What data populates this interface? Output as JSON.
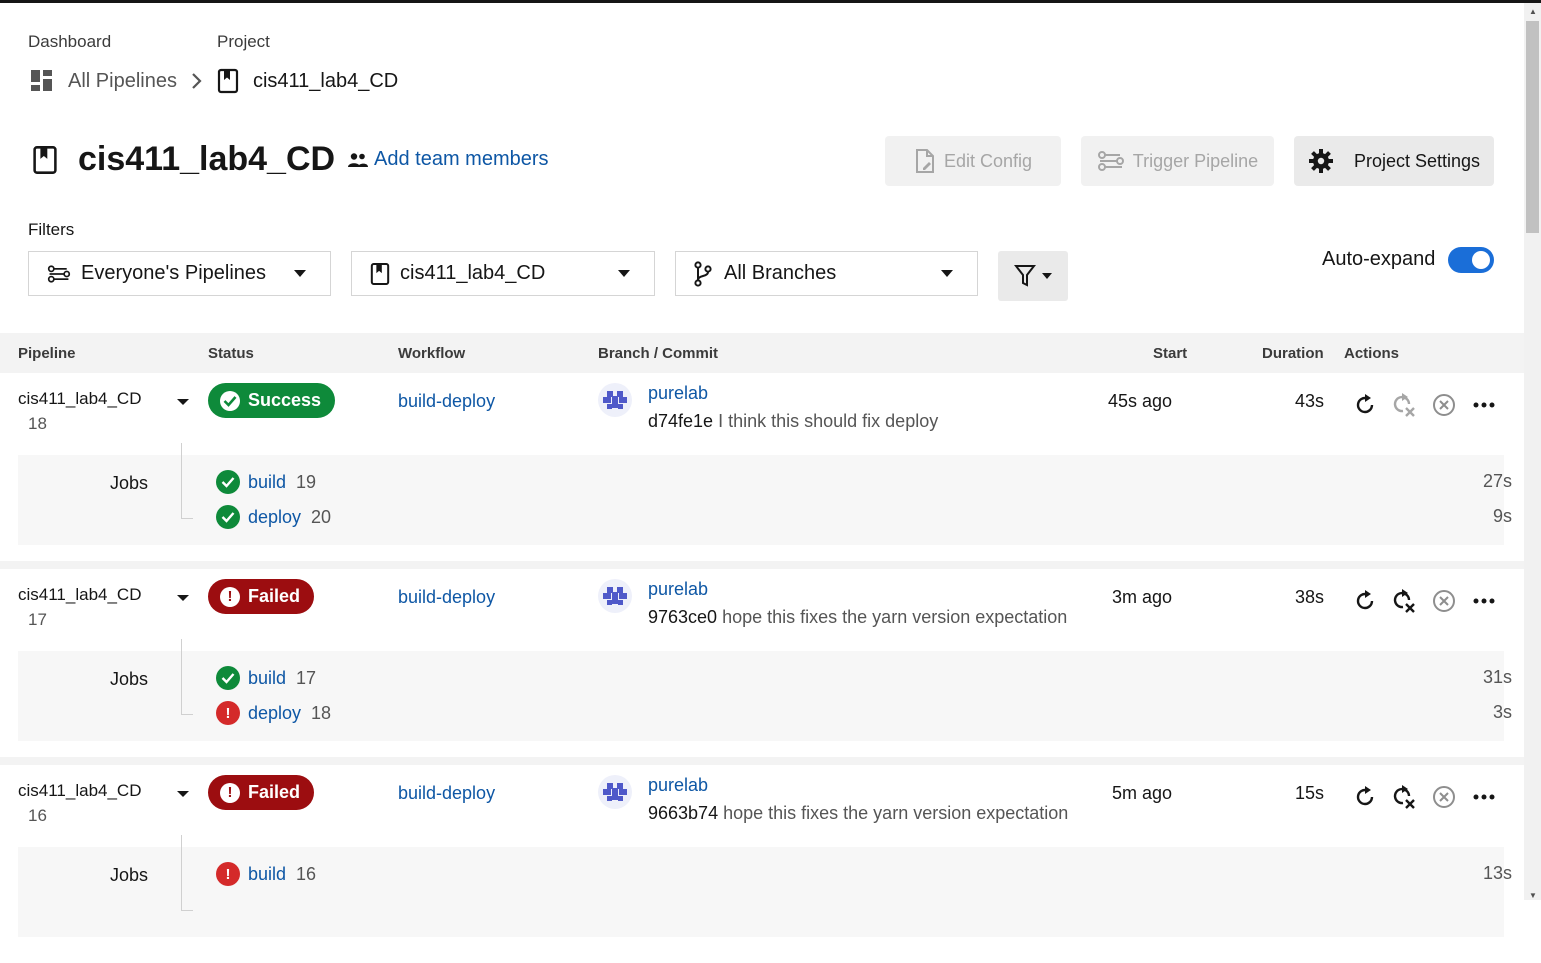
{
  "breadcrumb": {
    "dashboard_label": "Dashboard",
    "project_label": "Project",
    "all_pipelines": "All Pipelines",
    "project_name": "cis411_lab4_CD"
  },
  "header": {
    "title": "cis411_lab4_CD",
    "add_team": "Add team members",
    "edit_config": "Edit Config",
    "trigger_pipeline": "Trigger Pipeline",
    "project_settings": "Project Settings"
  },
  "filters": {
    "label": "Filters",
    "pipelines": "Everyone's Pipelines",
    "project": "cis411_lab4_CD",
    "branches": "All Branches",
    "auto_expand": "Auto-expand",
    "auto_expand_on": true
  },
  "table": {
    "headers": {
      "pipeline": "Pipeline",
      "status": "Status",
      "workflow": "Workflow",
      "branch_commit": "Branch / Commit",
      "start": "Start",
      "duration": "Duration",
      "actions": "Actions"
    },
    "jobs_label": "Jobs",
    "rows": [
      {
        "name": "cis411_lab4_CD",
        "number": "18",
        "status": "Success",
        "status_type": "success",
        "workflow": "build-deploy",
        "author": "purelab",
        "sha": "d74fe1e",
        "message": "I think this should fix deploy",
        "start": "45s ago",
        "duration": "43s",
        "jobs": [
          {
            "name": "build",
            "number": "19",
            "duration": "27s",
            "ok": true
          },
          {
            "name": "deploy",
            "number": "20",
            "duration": "9s",
            "ok": true
          }
        ]
      },
      {
        "name": "cis411_lab4_CD",
        "number": "17",
        "status": "Failed",
        "status_type": "failed",
        "workflow": "build-deploy",
        "author": "purelab",
        "sha": "9763ce0",
        "message": "hope this fixes the yarn version expectation",
        "start": "3m ago",
        "duration": "38s",
        "jobs": [
          {
            "name": "build",
            "number": "17",
            "duration": "31s",
            "ok": true
          },
          {
            "name": "deploy",
            "number": "18",
            "duration": "3s",
            "ok": false
          }
        ]
      },
      {
        "name": "cis411_lab4_CD",
        "number": "16",
        "status": "Failed",
        "status_type": "failed",
        "workflow": "build-deploy",
        "author": "purelab",
        "sha": "9663b74",
        "message": "hope this fixes the yarn version expectation",
        "start": "5m ago",
        "duration": "15s",
        "jobs": [
          {
            "name": "build",
            "number": "16",
            "duration": "13s",
            "ok": false
          }
        ]
      }
    ]
  },
  "colors": {
    "link": "#0e57a5",
    "success": "#0e8a3a",
    "failed": "#9c0d10",
    "toggle": "#1a6ed8"
  }
}
